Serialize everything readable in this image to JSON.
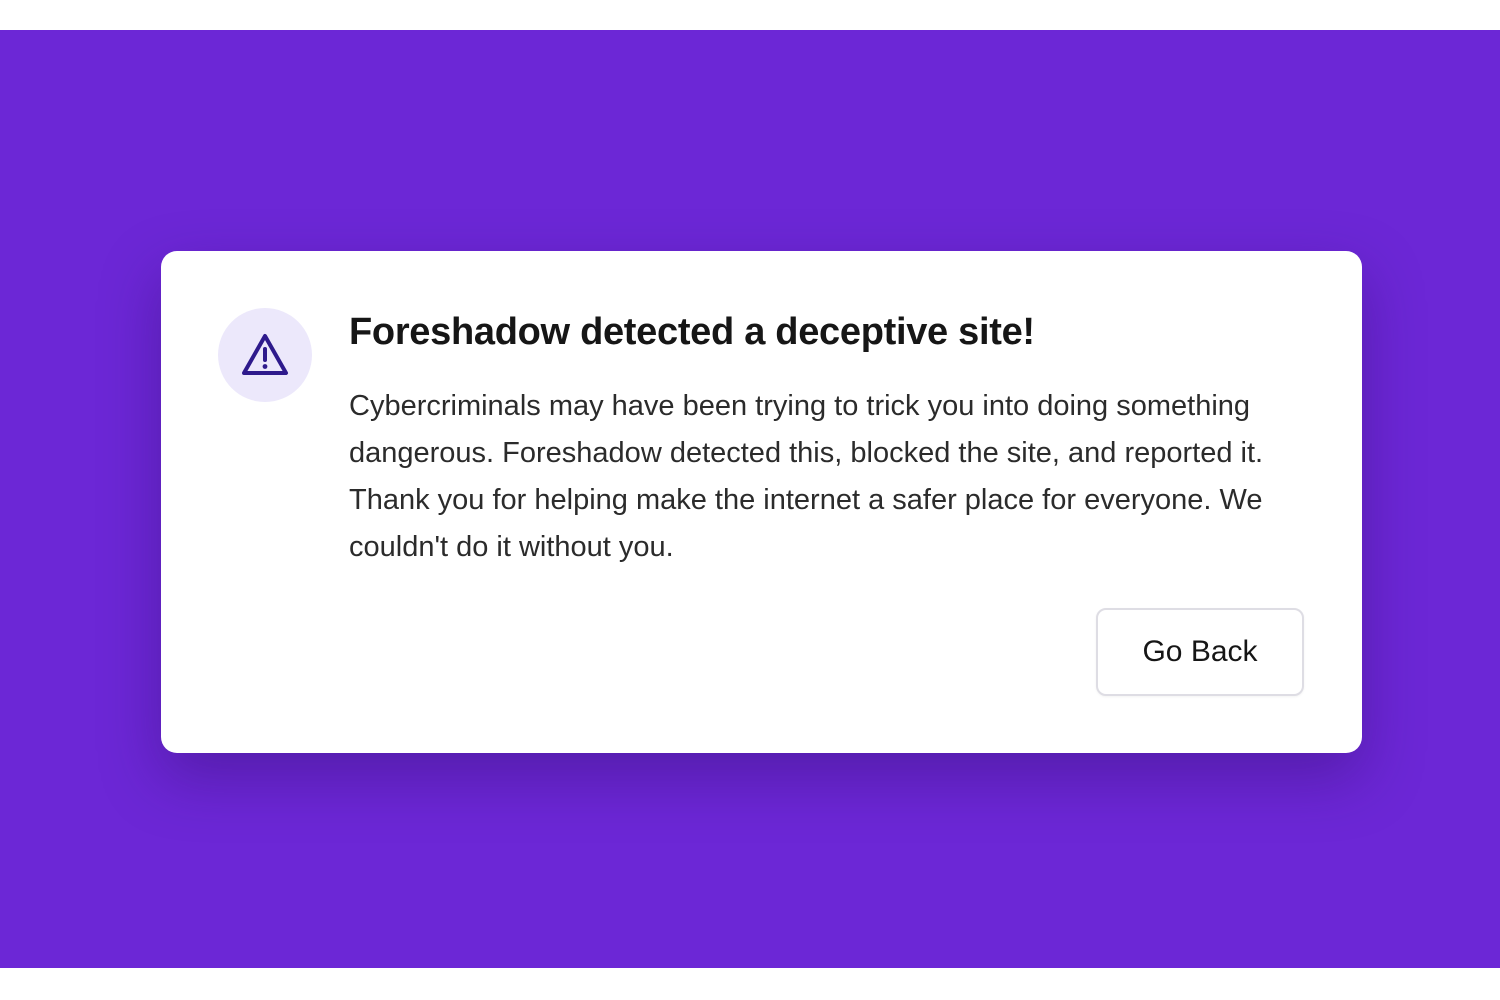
{
  "colors": {
    "background": "#6c27d6",
    "card": "#ffffff",
    "icon_circle": "#ece8fb",
    "icon_stroke": "#2e1a8c",
    "text": "#161616"
  },
  "alert": {
    "icon": "warning-triangle-icon",
    "title": "Foreshadow detected a deceptive site!",
    "message": "Cybercriminals may have been trying to trick you into doing something dangerous. Foreshadow detected this, blocked the site, and reported it. Thank you for helping make the internet a safer place for everyone. We couldn't do it without you.",
    "button_label": "Go Back"
  }
}
